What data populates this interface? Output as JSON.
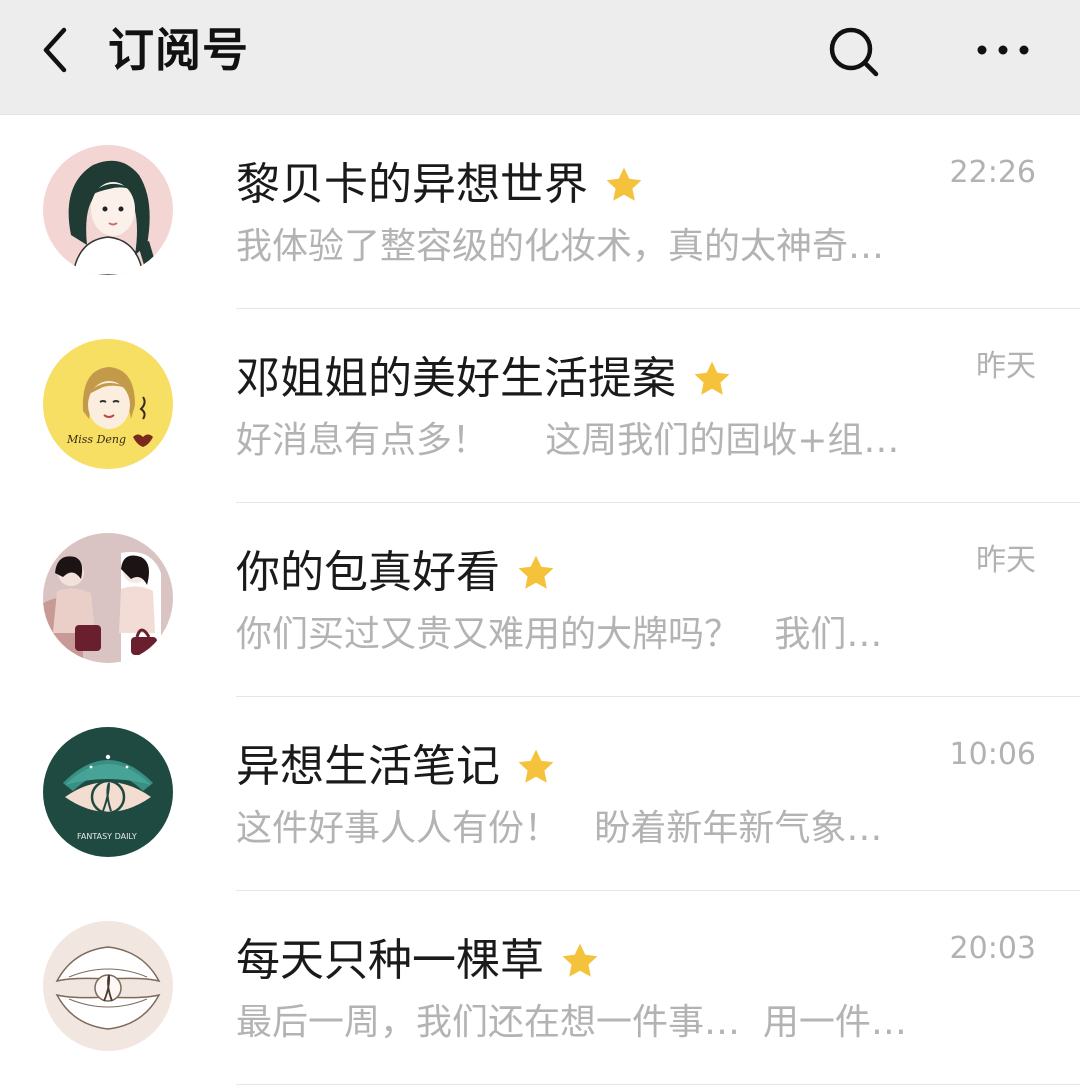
{
  "header": {
    "title": "订阅号",
    "back_icon": "chevron-left-icon",
    "search_icon": "search-icon",
    "more_icon": "more-dots-icon",
    "background": "#ededed"
  },
  "accent": {
    "star_color": "#f5c33b"
  },
  "subscriptions": [
    {
      "name": "黎贝卡的异想世界",
      "time": "22:26",
      "preview": "我体验了整容级的化妆术，真的太神奇…",
      "starred": true
    },
    {
      "name": "邓姐姐的美好生活提案",
      "time": "昨天",
      "preview": "好消息有点多！     这周我们的固收+组…",
      "starred": true,
      "avatar_text": "Miss Deng"
    },
    {
      "name": "你的包真好看",
      "time": "昨天",
      "preview": "你们买过又贵又难用的大牌吗？   我们…",
      "starred": true
    },
    {
      "name": "异想生活笔记",
      "time": "10:06",
      "preview": "这件好事人人有份！   盼着新年新气象…",
      "starred": true,
      "avatar_text": "FANTASY DAILY"
    },
    {
      "name": "每天只种一棵草",
      "time": "20:03",
      "preview": "最后一周，我们还在想一件事…  用一件…",
      "starred": true
    }
  ]
}
